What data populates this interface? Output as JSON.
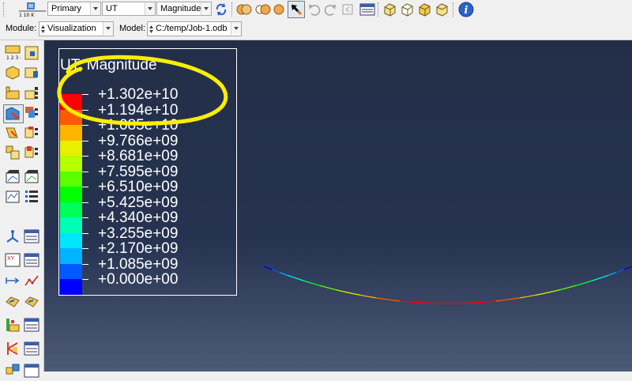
{
  "toolbar_top": {
    "variable_position": "Primary",
    "field_output": "UT",
    "component": "Magnitude"
  },
  "toolbar_module": {
    "module_label": "Module:",
    "module_value": "Visualization",
    "model_label": "Model:",
    "model_value": "C:/temp/Job-1.odb"
  },
  "legend": {
    "title": "UT, Magnitude",
    "values": [
      "+1.302e+10",
      "+1.194e+10",
      "+1.085e+10",
      "+9.766e+09",
      "+8.681e+09",
      "+7.595e+09",
      "+6.510e+09",
      "+5.425e+09",
      "+4.340e+09",
      "+3.255e+09",
      "+2.170e+09",
      "+1.085e+09",
      "+0.000e+00"
    ],
    "colors": [
      "#ff0000",
      "#ff5a00",
      "#ffb400",
      "#e6f000",
      "#b4ff00",
      "#5aff00",
      "#00ff00",
      "#00ff5a",
      "#00ffb4",
      "#00e6ff",
      "#00b4ff",
      "#005aff",
      "#0000ff"
    ]
  },
  "annotation_color": "#ffee00",
  "icons": {
    "sidebar": [
      "field-output-icon",
      "node-label-icon",
      "deformed-shape-icon",
      "contour-plot-icon",
      "symbol-plot-icon",
      "material-orientation-icon",
      "animation-icon",
      "time-history-icon",
      "xy-data-icon",
      "xy-plot-icon",
      "path-icon",
      "display-group-icon",
      "view-cut-icon",
      "free-body-icon",
      "query-icon"
    ]
  }
}
